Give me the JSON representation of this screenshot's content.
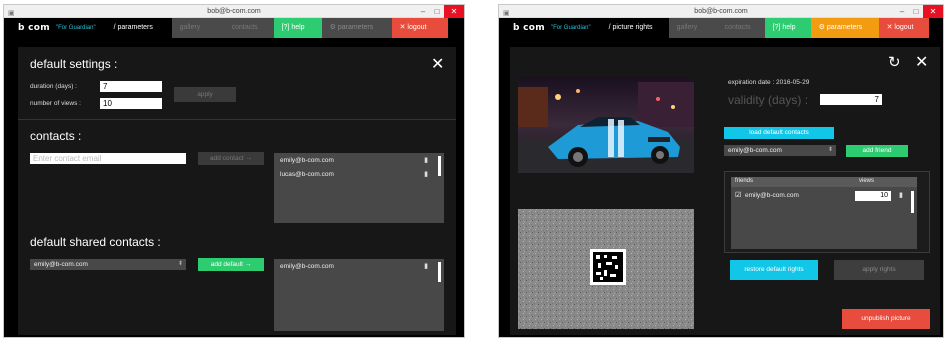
{
  "window_title": "bob@b-com.com",
  "brand": "b com",
  "brand_sub": "\"For Guardian\"",
  "left": {
    "current_tab": "/ parameters",
    "tabs": {
      "gallery": "gallery",
      "contacts": "contacts",
      "help": "[?] help",
      "parameters": "parameters",
      "logout": "logout"
    },
    "default_settings": {
      "title": "default settings :",
      "duration_label": "duration (days) :",
      "duration_value": "7",
      "views_label": "number of views :",
      "views_value": "10",
      "apply": "apply"
    },
    "contacts": {
      "title": "contacts :",
      "email_placeholder": "Enter contact email",
      "add_button": "add contact →",
      "list": [
        "emily@b-com.com",
        "lucas@b-com.com"
      ]
    },
    "shared": {
      "title": "default shared contacts :",
      "select_value": "emily@b-com.com",
      "add_button": "add default →",
      "list": [
        "emily@b-com.com"
      ]
    }
  },
  "right": {
    "current_tab": "/ picture rights",
    "tabs": {
      "gallery": "gallery",
      "contacts": "contacts",
      "help": "[?] help",
      "parameters": "parameters",
      "logout": "logout"
    },
    "expiration": "expiration date : 2016-05-29",
    "validity_label": "validity (days) :",
    "validity_value": "7",
    "load_contacts": "load default contacts",
    "friend_select": "emily@b-com.com",
    "add_friend": "add friend",
    "table": {
      "col_friends": "friends",
      "col_views": "views",
      "rows": [
        {
          "email": "emily@b-com.com",
          "views": "10"
        }
      ]
    },
    "restore": "restore default rights",
    "apply": "apply rights",
    "unpublish": "unpublish picture"
  },
  "colors": {
    "green": "#2ecc71",
    "cyan": "#12c6e8",
    "red": "#e84c3d",
    "orange": "#f39c12"
  }
}
